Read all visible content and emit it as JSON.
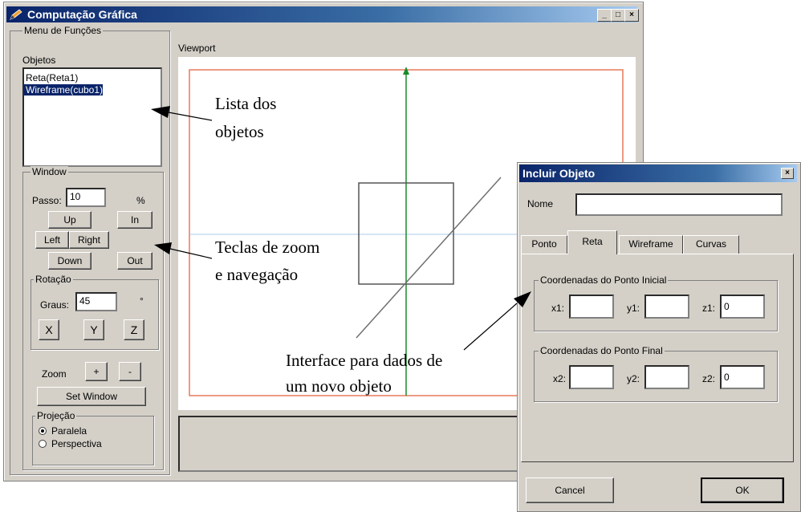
{
  "window": {
    "title": "Computação Gráfica",
    "minimize_glyph": "_",
    "maximize_glyph": "□",
    "close_glyph": "×"
  },
  "left_panel": {
    "menu_label": "Menu de Funções",
    "objects_label": "Objetos",
    "objects": [
      {
        "label": "Reta(Reta1)",
        "selected": false
      },
      {
        "label": "Wireframe(cubo1)",
        "selected": true
      }
    ],
    "window_group": {
      "label": "Window",
      "step_label": "Passo:",
      "step_value": "10",
      "step_unit": "%",
      "up": "Up",
      "in": "In",
      "left": "Left",
      "right": "Right",
      "down": "Down",
      "out": "Out"
    },
    "rotation_group": {
      "label": "Rotação",
      "degrees_label": "Graus:",
      "degrees_value": "45",
      "degrees_unit": "°",
      "x": "X",
      "y": "Y",
      "z": "Z"
    },
    "zoom_label": "Zoom",
    "zoom_plus": "+",
    "zoom_minus": "-",
    "set_window": "Set Window",
    "projection_group": {
      "label": "Projeção",
      "options": [
        "Paralela",
        "Perspectiva"
      ],
      "selected": "Paralela"
    }
  },
  "viewport": {
    "label": "Viewport",
    "border_color": "#e8785a",
    "axis_vertical_color": "#1a8a2a",
    "axis_horizontal_color": "#a8c8e8",
    "shape_color": "#707070"
  },
  "callouts": {
    "objects_list": [
      "Lista dos",
      "objetos"
    ],
    "zoom_keys": [
      "Teclas de zoom",
      "e navegação"
    ],
    "new_object_interface": [
      "Interface para dados de",
      "um novo objeto"
    ]
  },
  "dialog": {
    "title": "Incluir Objeto",
    "close_glyph": "×",
    "name_label": "Nome",
    "name_value": "",
    "tabs": [
      "Ponto",
      "Reta",
      "Wireframe",
      "Curvas"
    ],
    "active_tab": "Reta",
    "initial_point_group": {
      "label": "Coordenadas do Ponto Inicial",
      "x1_label": "x1:",
      "x1_value": "",
      "y1_label": "y1:",
      "y1_value": "",
      "z1_label": "z1:",
      "z1_value": "0"
    },
    "final_point_group": {
      "label": "Coordenadas do Ponto Final",
      "x2_label": "x2:",
      "x2_value": "",
      "y2_label": "y2:",
      "y2_value": "",
      "z2_label": "z2:",
      "z2_value": "0"
    },
    "cancel": "Cancel",
    "ok": "OK"
  }
}
